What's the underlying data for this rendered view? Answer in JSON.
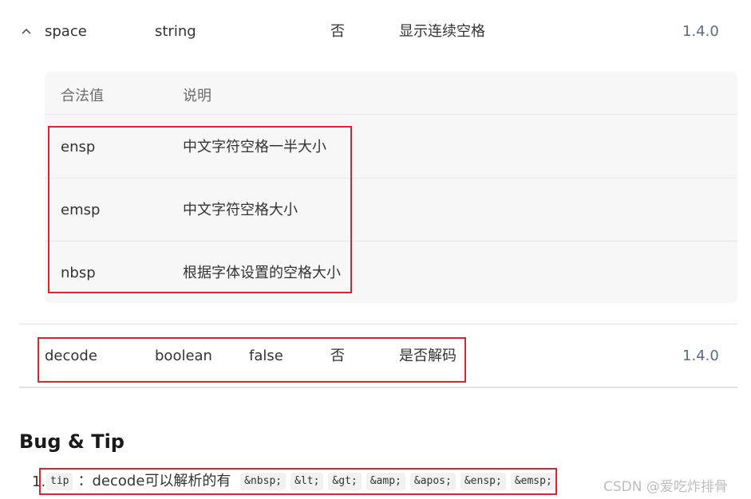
{
  "space_row": {
    "name": "space",
    "type": "string",
    "required": "否",
    "description": "显示连续空格",
    "version": "1.4.0"
  },
  "space_values": {
    "header": {
      "value": "合法值",
      "desc": "说明"
    },
    "rows": [
      {
        "value": "ensp",
        "desc": "中文字符空格一半大小"
      },
      {
        "value": "emsp",
        "desc": "中文字符空格大小"
      },
      {
        "value": "nbsp",
        "desc": "根据字体设置的空格大小"
      }
    ]
  },
  "decode_row": {
    "name": "decode",
    "type": "boolean",
    "default": "false",
    "required": "否",
    "description": "是否解码",
    "version": "1.4.0"
  },
  "section": {
    "heading": "Bug & Tip",
    "list_number": "1.",
    "tip_code": "tip",
    "tip_text": "：decode可以解析的有",
    "entities": [
      "&nbsp;",
      "&lt;",
      "&gt;",
      "&amp;",
      "&apos;",
      "&ensp;",
      "&emsp;"
    ]
  },
  "watermark": "CSDN @爱吃炸排骨",
  "colors": {
    "highlight_border": "#d9262c",
    "version_text": "#5a6b82"
  }
}
